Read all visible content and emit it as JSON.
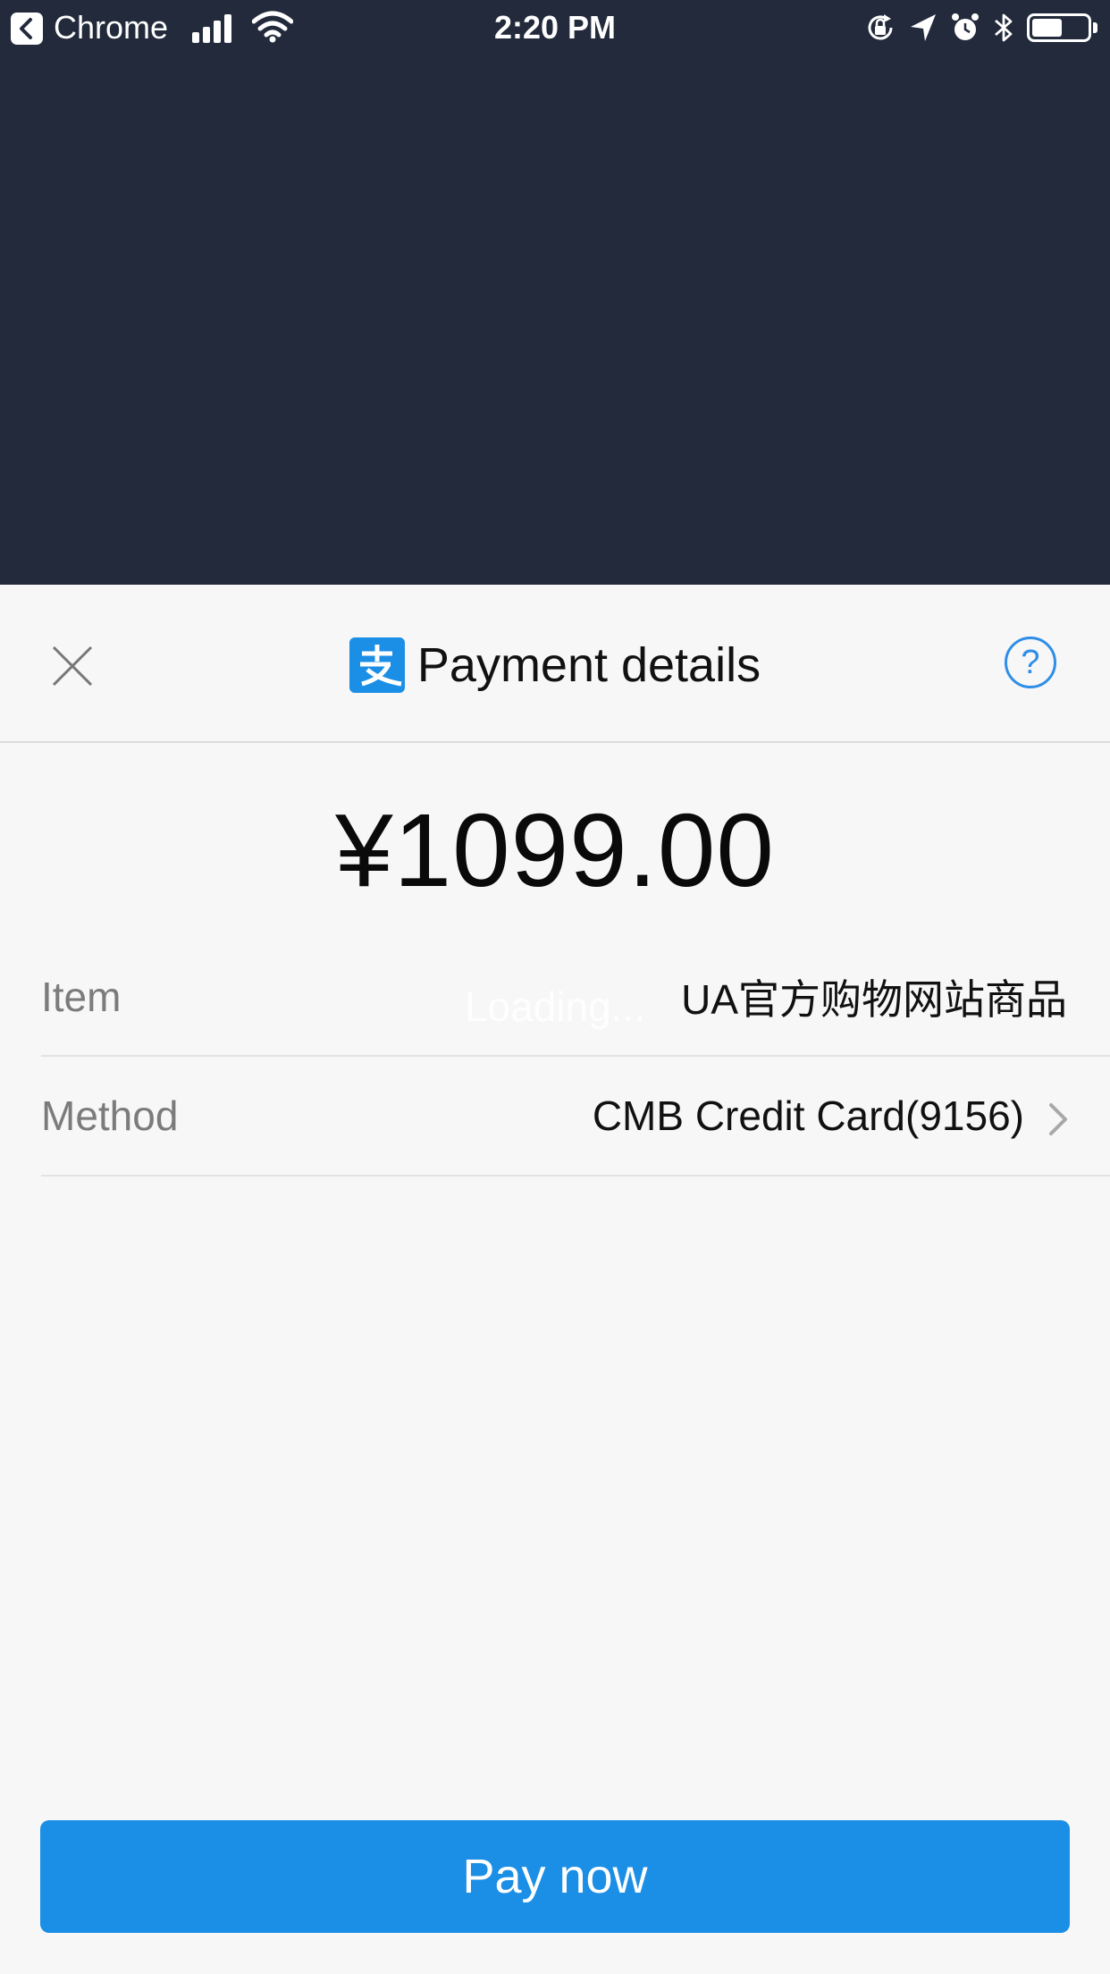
{
  "status_bar": {
    "back_app": "Chrome",
    "time": "2:20 PM",
    "battery_level": 0.55
  },
  "sheet": {
    "title": "Payment details",
    "amount": "¥1099.00",
    "loading_text": "Loading...",
    "rows": [
      {
        "label": "Item",
        "value": "UA官方购物网站商品"
      },
      {
        "label": "Method",
        "value": "CMB Credit Card(9156)"
      }
    ],
    "help_glyph": "?",
    "pay_button": "Pay now"
  },
  "icons": {
    "close": "close-icon",
    "help": "help-icon",
    "logo": "alipay-logo-icon",
    "chevron": "chevron-right-icon"
  },
  "colors": {
    "accent": "#1b8ee6",
    "backdrop": "#222a3b",
    "sheet_background": "#f7f7f8"
  }
}
